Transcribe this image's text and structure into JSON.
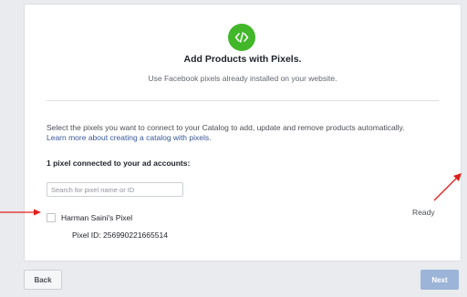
{
  "header": {
    "icon": "code-icon",
    "title": "Add Products with Pixels.",
    "subtitle": "Use Facebook pixels already installed on your website."
  },
  "body": {
    "description": "Select the pixels you want to connect to your Catalog to add, update and remove products automatically.",
    "learn_more_link": "Learn more about creating a catalog with pixels.",
    "connected_count": "1 pixel connected to your ad accounts:",
    "search": {
      "placeholder": "Search for pixel name or ID",
      "value": ""
    },
    "pixels": [
      {
        "name": "Harman Saini's Pixel",
        "id_label": "Pixel ID: 256990221665514",
        "status": "Ready",
        "checked": false
      }
    ]
  },
  "footer": {
    "back_label": "Back",
    "next_label": "Next"
  },
  "colors": {
    "accent_green": "#42b72a",
    "link_blue": "#385898",
    "next_disabled": "#9cb4d8",
    "annotation_red": "#e0201b"
  }
}
